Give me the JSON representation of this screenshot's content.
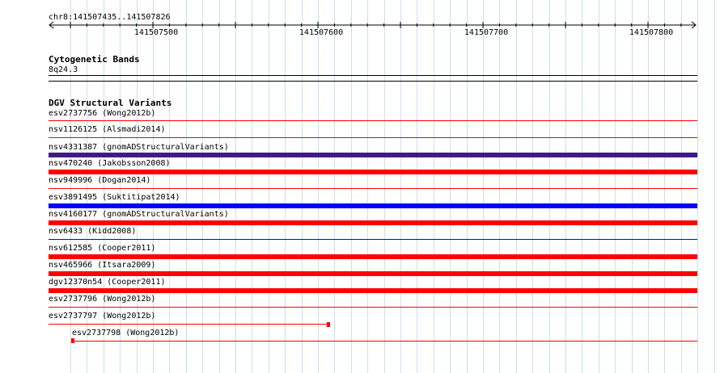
{
  "location": "chr8:141507435..141507826",
  "ruler": {
    "ticks": [
      "141507500",
      "141507600",
      "141507700",
      "141507800"
    ]
  },
  "cytoband": {
    "title": "Cytogenetic Bands",
    "band": "8q24.3"
  },
  "dgv": {
    "title": "DGV Structural Variants",
    "variants": [
      {
        "label": "esv2737756 (Wong2012b)",
        "kind": "loss"
      },
      {
        "label": "nsv1126125 (Alsmadi2014)",
        "kind": "loss"
      },
      {
        "label": "nsv4331387 (gnomADStructuralVariants)",
        "kind": "complex"
      },
      {
        "label": "nsv470240 (Jakobsson2008)",
        "kind": "loss"
      },
      {
        "label": "nsv949996 (Dogan2014)",
        "kind": "loss"
      },
      {
        "label": "esv3891495 (Suktitipat2014)",
        "kind": "gain"
      },
      {
        "label": "nsv4160177 (gnomADStructuralVariants)",
        "kind": "loss"
      },
      {
        "label": "nsv6433 (Kidd2008)",
        "kind": "gain"
      },
      {
        "label": "nsv612585 (Cooper2011)",
        "kind": "loss"
      },
      {
        "label": "nsv465966 (Itsara2009)",
        "kind": "loss"
      },
      {
        "label": "dgv12370n54 (Cooper2011)",
        "kind": "loss"
      },
      {
        "label": "esv2737796 (Wong2012b)",
        "kind": "loss"
      },
      {
        "label": "esv2737797 (Wong2012b)",
        "kind": "loss"
      },
      {
        "label": "esv2737798 (Wong2012b)",
        "kind": "loss"
      }
    ]
  },
  "colors": {
    "loss": "#ff0000",
    "gain": "#0000ff",
    "complex": "#3f1b87",
    "grid": "#c6e2ec",
    "background": "#ffffff"
  }
}
